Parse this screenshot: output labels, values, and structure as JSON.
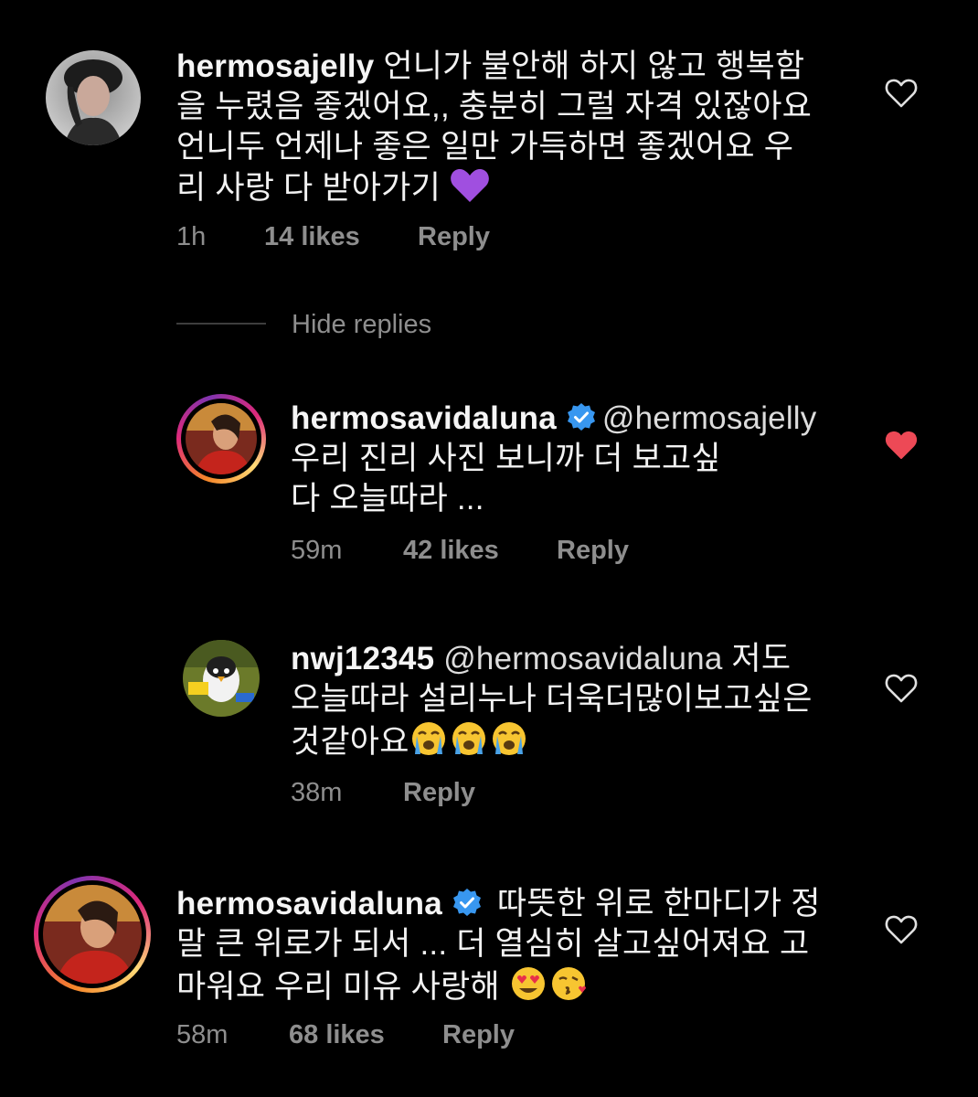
{
  "comments": [
    {
      "username": "hermosajelly",
      "text_lines": [
        "언니가 불안해 하지 않고 행복함",
        "을 누렸음 좋겠어요,, 충분히 그럴 자격 있잖아요",
        "언니두 언제나 좋은 일만 가득하면 좋겠어요 우",
        "리 사랑 다 받아가기"
      ],
      "emoji": "purple-heart",
      "time": "1h",
      "likes": "14 likes",
      "reply_label": "Reply",
      "liked": false
    },
    {
      "username": "hermosavidaluna",
      "verified": true,
      "mention": "@hermosajelly",
      "text_lines": [
        "우리 진리 사진 보니까 더 보고싶",
        "다 오늘따라 ..."
      ],
      "time": "59m",
      "likes": "42 likes",
      "reply_label": "Reply",
      "liked": true
    },
    {
      "username": "nwj12345",
      "mention": "@hermosavidaluna",
      "text_lines": [
        "저도",
        "오늘따라 설리누나 더욱더많이보고싶은",
        "것같아요"
      ],
      "emoji": "crying-faces-x3",
      "time": "38m",
      "reply_label": "Reply",
      "liked": false
    },
    {
      "username": "hermosavidaluna",
      "verified": true,
      "text_lines": [
        "따뜻한 위로 한마디가 정",
        "말 큰 위로가 되서 ... 더 열심히 살고싶어져요 고",
        "마워요 우리 미유 사랑해"
      ],
      "emoji": "heart-eyes-and-kiss",
      "time": "58m",
      "likes": "68 likes",
      "reply_label": "Reply",
      "liked": false
    }
  ],
  "hide_replies_label": "Hide replies",
  "colors": {
    "background": "#000000",
    "meta_gray": "#8e8e8e",
    "liked_red": "#ed4956",
    "verified_blue": "#3897f0"
  }
}
